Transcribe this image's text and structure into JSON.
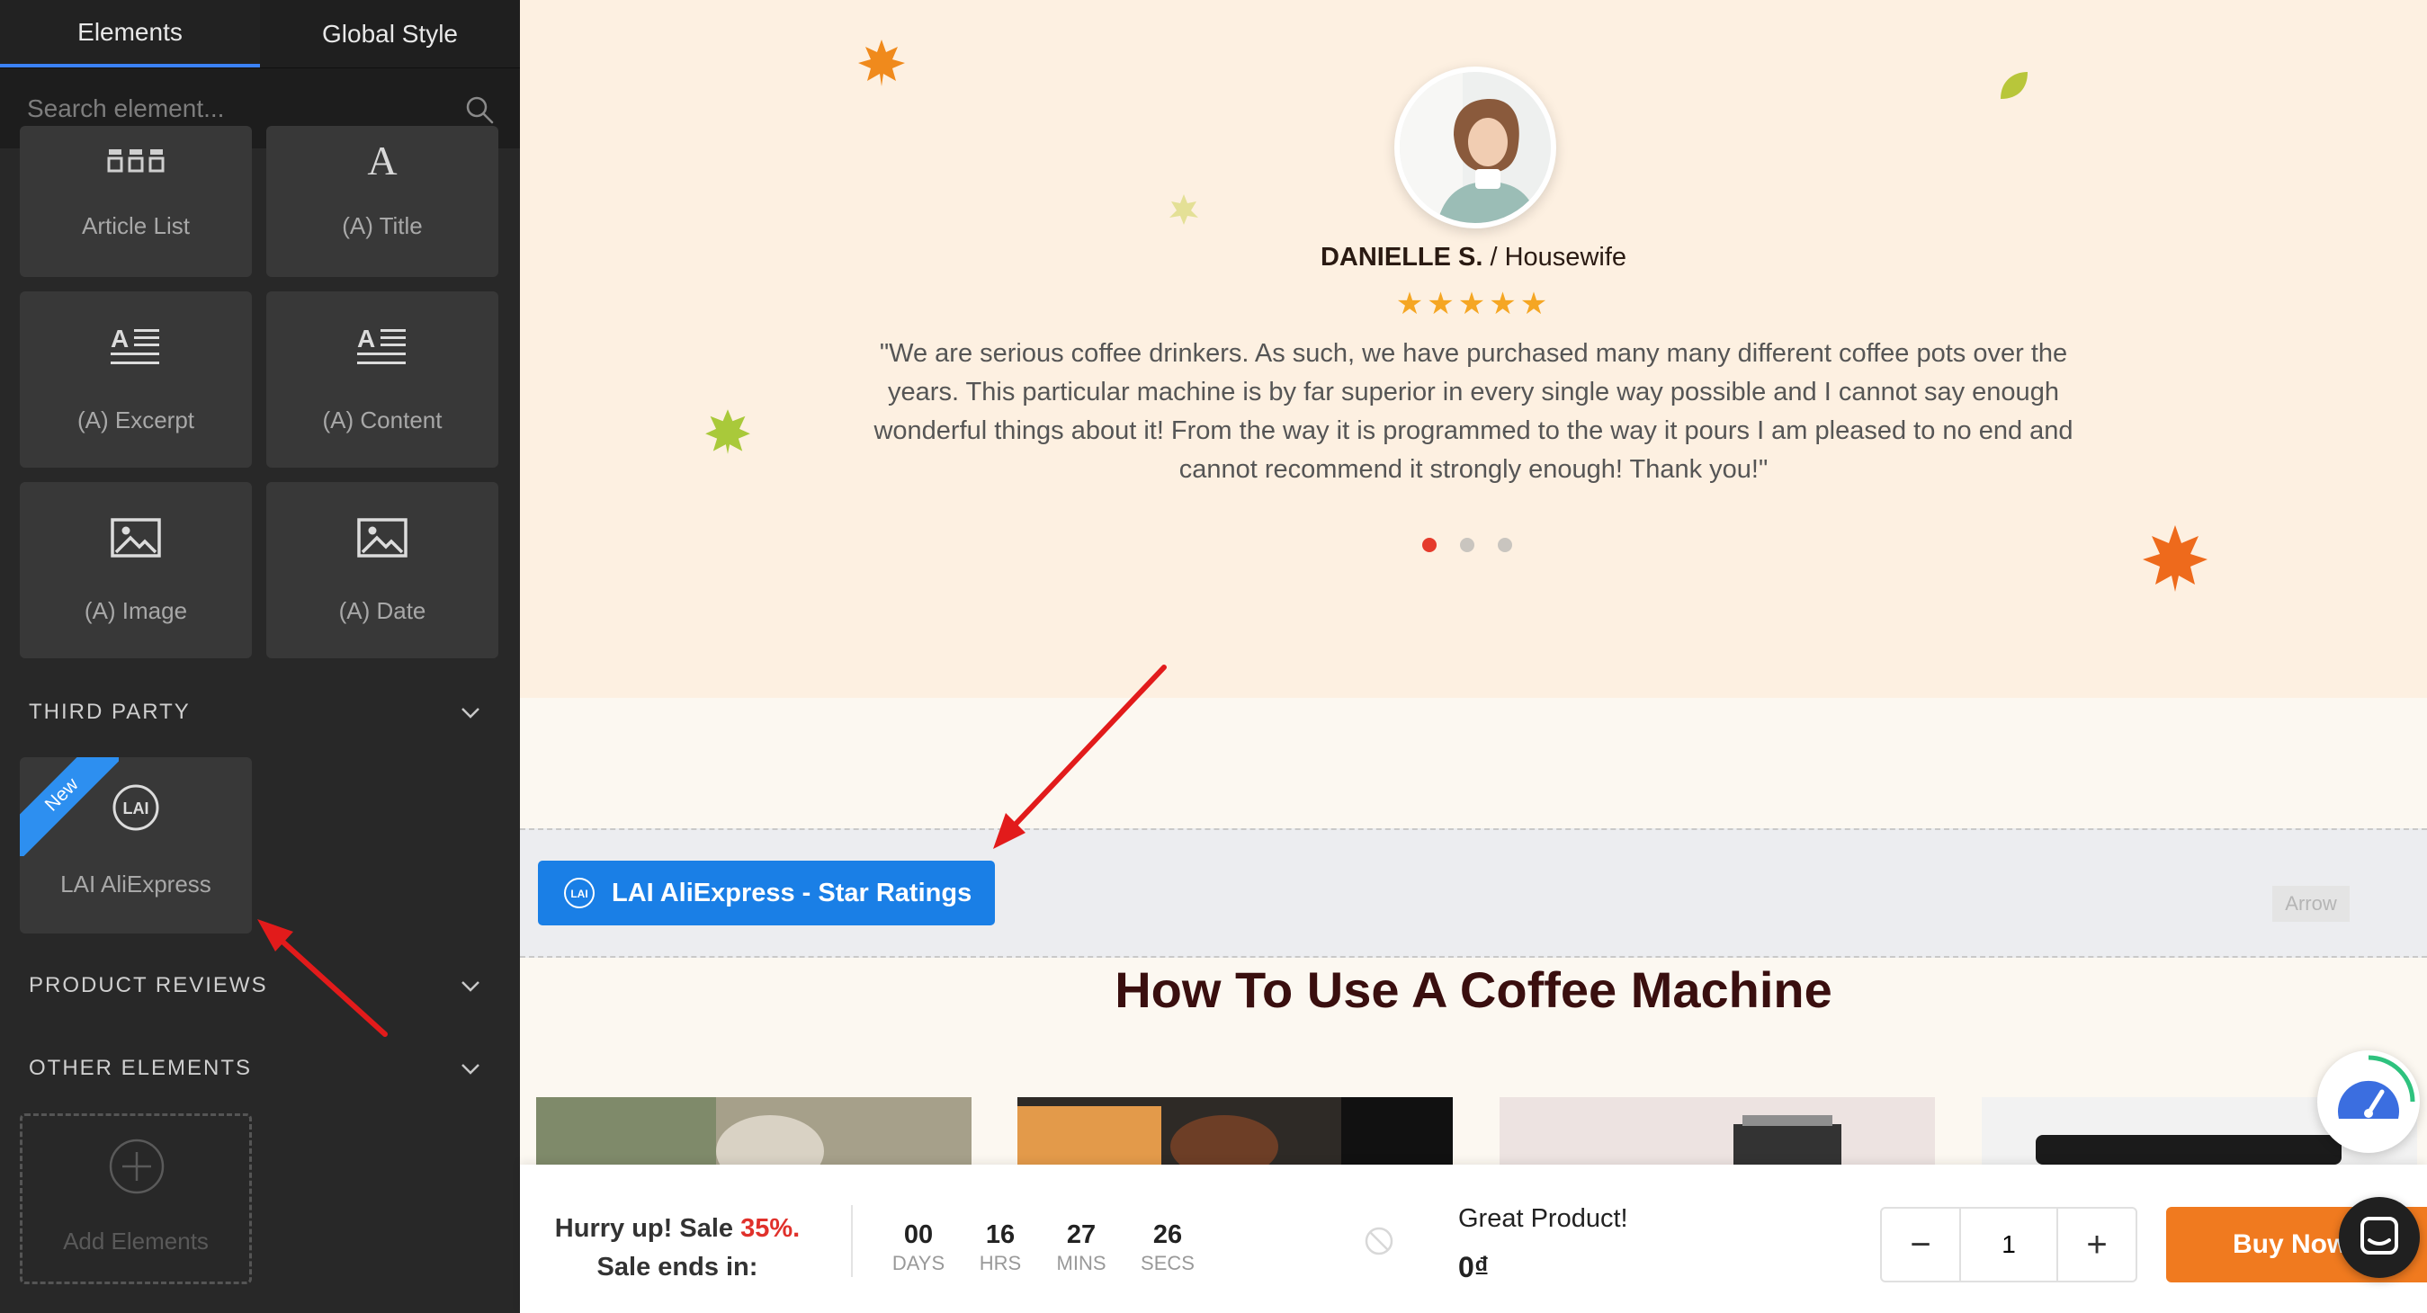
{
  "sidebar": {
    "tabs": [
      {
        "label": "Elements"
      },
      {
        "label": "Global Style"
      }
    ],
    "search": {
      "placeholder": "Search element..."
    },
    "tiles": [
      {
        "label": "Article List",
        "icon": "article-list-icon"
      },
      {
        "label": "(A) Title",
        "icon": "title-icon"
      },
      {
        "label": "(A) Excerpt",
        "icon": "excerpt-icon"
      },
      {
        "label": "(A) Content",
        "icon": "content-icon"
      },
      {
        "label": "(A) Image",
        "icon": "image-icon"
      },
      {
        "label": "(A) Date",
        "icon": "image-icon"
      }
    ],
    "sections": {
      "third_party": "THIRD PARTY",
      "product_reviews": "PRODUCT REVIEWS",
      "other_elements": "OTHER ELEMENTS"
    },
    "third_party_tile": {
      "label": "LAI AliExpress",
      "badge": "New",
      "icon": "lai-logo-icon"
    },
    "add_elements": {
      "label": "Add Elements"
    }
  },
  "testimonial": {
    "name": "DANIELLE S.",
    "separator": " / ",
    "role": "Housewife",
    "stars": "★★★★★",
    "quote": "\"We are serious coffee drinkers. As such, we have purchased many many different coffee pots over the years. This particular machine is by far superior in every single way possible and I cannot say enough wonderful things about it! From the way it is programmed to the way it pours I am pleased to no end and cannot recommend it strongly enough! Thank you!\"",
    "slide_count": 3,
    "active_slide": 1
  },
  "app_block": {
    "button_label": "LAI AliExpress - Star Ratings",
    "tag": "Arrow"
  },
  "how_to": {
    "title": "How To Use A Coffee Machine"
  },
  "sticky_bar": {
    "hurry_prefix": "Hurry up! Sale ",
    "sale_percent": "35%.",
    "ends_in": "Sale ends in:",
    "countdown": [
      {
        "value": "00",
        "unit": "DAYS"
      },
      {
        "value": "16",
        "unit": "HRS"
      },
      {
        "value": "27",
        "unit": "MINS"
      },
      {
        "value": "26",
        "unit": "SECS"
      }
    ],
    "product_name": "Great Product!",
    "price": "0₫",
    "quantity": "1",
    "buy_label": "Buy Now"
  },
  "colors": {
    "accent_blue": "#1a7fe6",
    "buy_orange": "#f07a1f",
    "sale_red": "#e0312b",
    "annotation_red": "#e21b1b"
  }
}
